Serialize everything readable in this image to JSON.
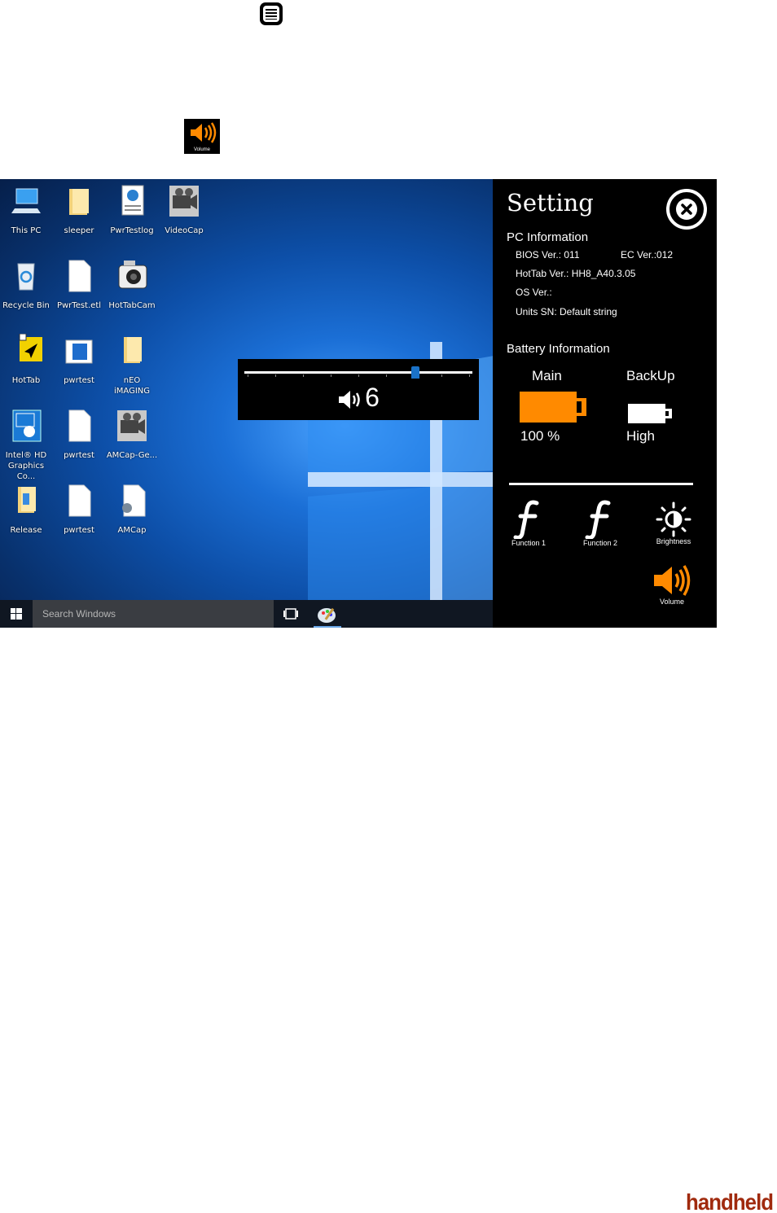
{
  "inline_icons": {
    "doc_icon": "list-document-icon",
    "volume_label": "Volume"
  },
  "desktop": {
    "icons": [
      {
        "label": "This PC",
        "icon": "computer-icon"
      },
      {
        "label": "sleeper",
        "icon": "folder-icon"
      },
      {
        "label": "PwrTestlog",
        "icon": "web-document-icon"
      },
      {
        "label": "VideoCap",
        "icon": "video-camera-icon"
      },
      {
        "label": "Recycle Bin",
        "icon": "recycle-bin-icon"
      },
      {
        "label": "PwrTest.etl",
        "icon": "file-icon"
      },
      {
        "label": "HotTabCam",
        "icon": "camera-icon"
      },
      {
        "label": "HotTab",
        "icon": "hottab-icon"
      },
      {
        "label": "pwrtest",
        "icon": "window-file-icon"
      },
      {
        "label": "nEO iMAGING",
        "icon": "folder-icon"
      },
      {
        "label": "Intel® HD Graphics Co...",
        "icon": "intel-icon"
      },
      {
        "label": "pwrtest",
        "icon": "file-icon"
      },
      {
        "label": "AMCap-Ge...",
        "icon": "video-camera-icon"
      },
      {
        "label": "Release",
        "icon": "folder-icon"
      },
      {
        "label": "pwrtest",
        "icon": "file-icon"
      },
      {
        "label": "AMCap",
        "icon": "settings-file-icon"
      }
    ]
  },
  "osd": {
    "volume": "6",
    "level": 0.75,
    "icon": "speaker-icon"
  },
  "taskbar": {
    "search_placeholder": "Search Windows"
  },
  "panel": {
    "title": "Setting",
    "pc_info_heading": "PC Information",
    "bios": "BIOS Ver.: 011",
    "ec": "EC Ver.:012",
    "hottab": "HotTab Ver.: HH8_A40.3.05",
    "os": "OS Ver.:",
    "units_sn": "Units SN: Default string",
    "battery_heading": "Battery Information",
    "main_label": "Main",
    "backup_label": "BackUp",
    "main_value": "100 %",
    "backup_value": "High",
    "buttons": {
      "function1": "Function 1",
      "function2": "Function 2",
      "brightness": "Brightness",
      "volume": "Volume"
    },
    "accent": "#ff8a00"
  },
  "brand": "handheld"
}
